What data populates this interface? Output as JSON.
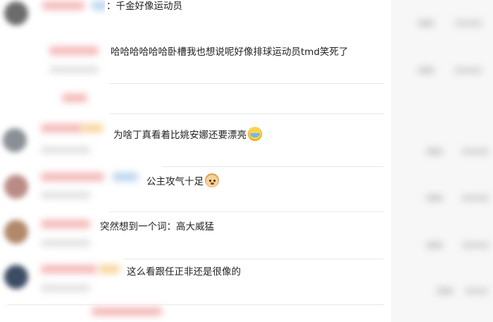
{
  "comments": [
    {
      "text": "：千金好像运动员"
    },
    {
      "text": "哈哈哈哈哈哈卧槽我也想说呢好像排球运动员tmd笑死了"
    },
    {
      "text": "为啥丁真看着比姚安娜还要漂亮",
      "emoji": "crying-laughing-emoji"
    },
    {
      "text": "公主攻气十足",
      "emoji": "doge-emoji"
    },
    {
      "text": "突然想到一个词：高大威猛"
    },
    {
      "text": "这么看跟任正非还是很像的"
    }
  ],
  "colors": {
    "background": "#ffffff",
    "text": "#222222",
    "blurred_side": "#f7f7f7"
  }
}
